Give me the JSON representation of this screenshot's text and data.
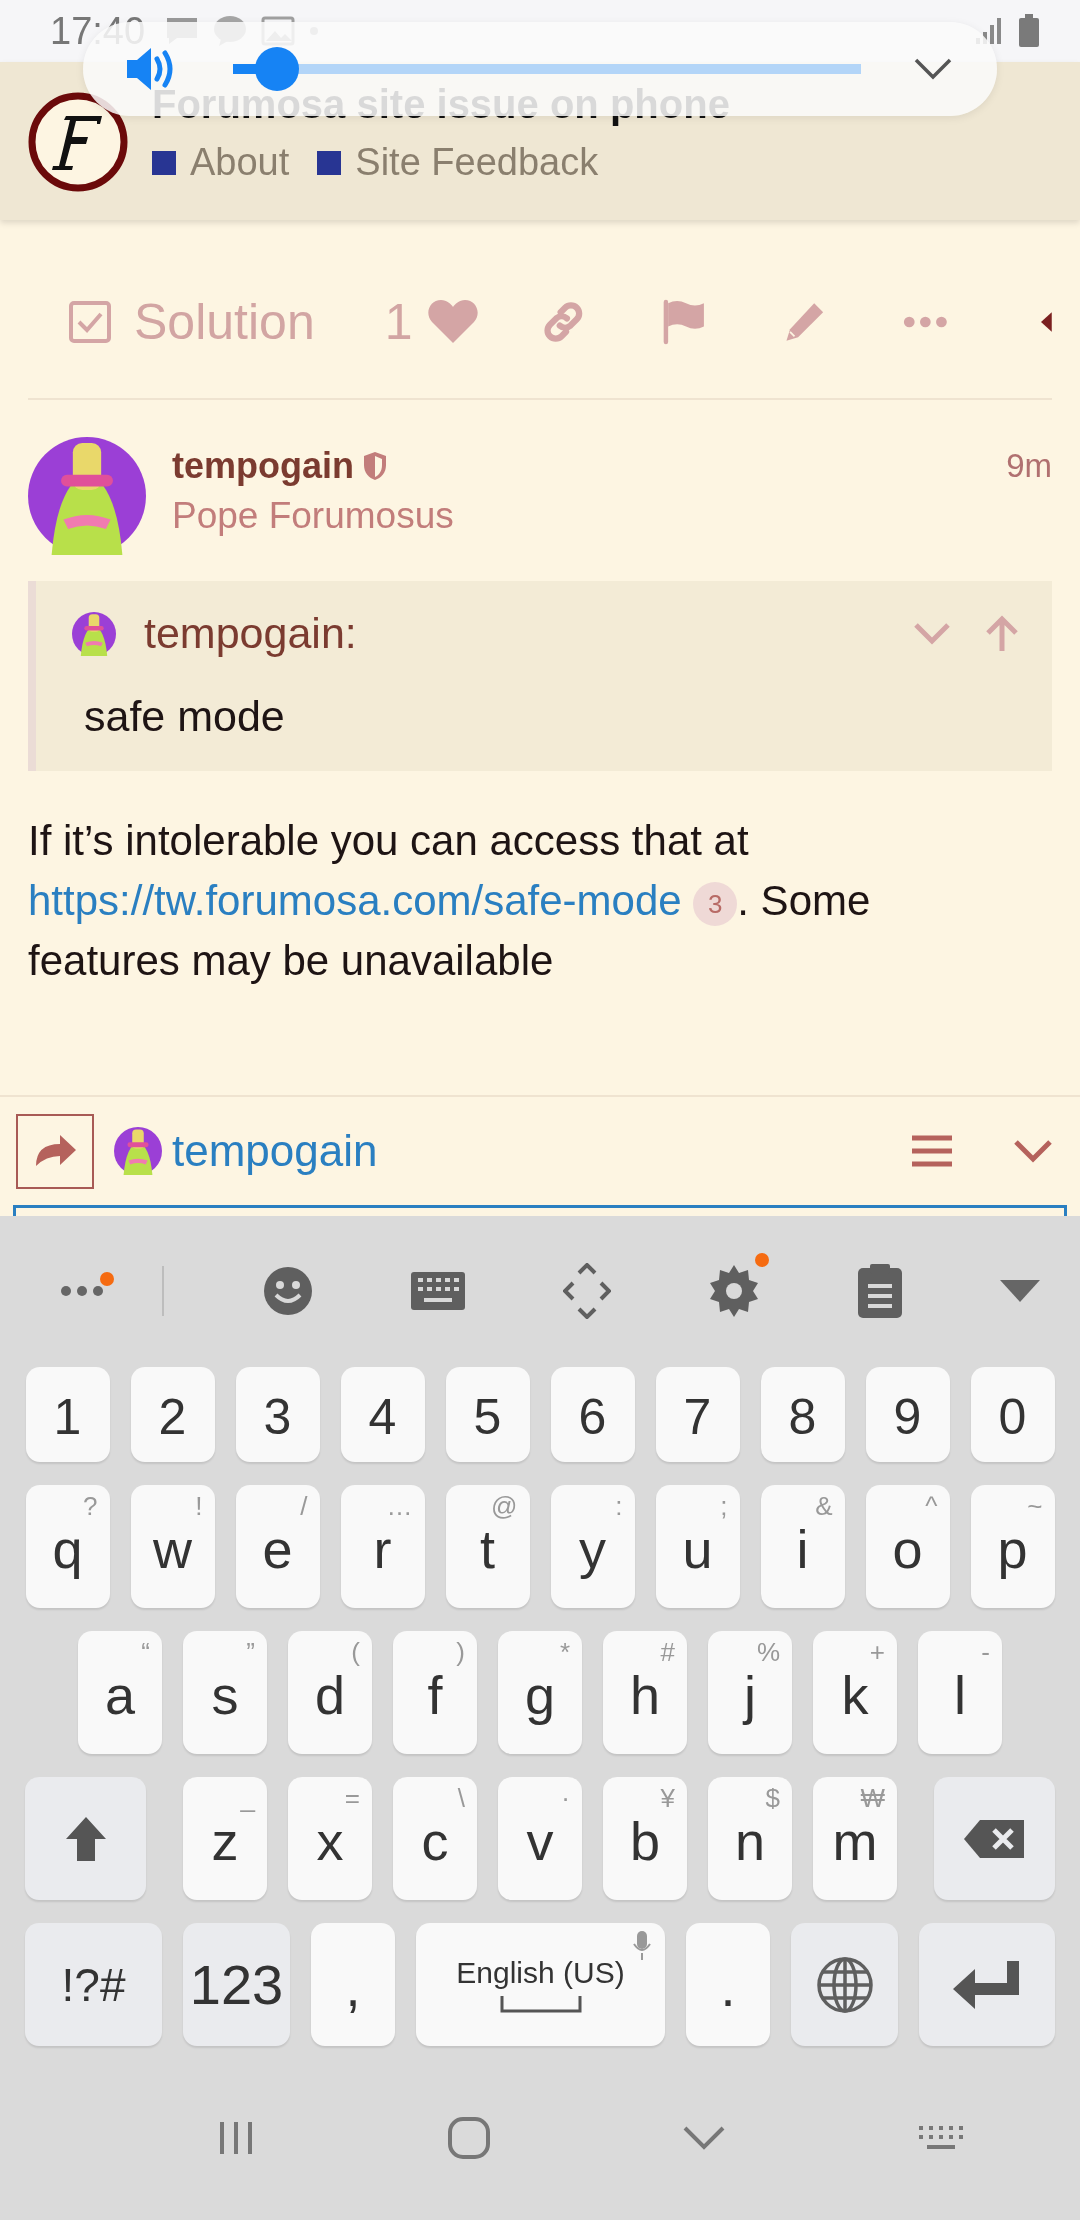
{
  "status_bar": {
    "time": "17:40"
  },
  "volume_popup": {
    "level": 0.07
  },
  "topic": {
    "title": "Forumosa site issue on phone",
    "categories": [
      {
        "name": "About"
      },
      {
        "name": "Site Feedback"
      }
    ]
  },
  "post_actions": {
    "solution_label": "Solution",
    "like_count": "1"
  },
  "post": {
    "username": "tempogain",
    "user_title": "Pope Forumosus",
    "time": "9m",
    "quote": {
      "author": "tempogain:",
      "text": "safe mode"
    },
    "body": {
      "text_before": "If it’s intolerable you can access that at ",
      "link": "https://tw.forumosa.com/safe-mode",
      "link_clicks": "3",
      "text_after": ". Some features may be unavailable"
    }
  },
  "composer": {
    "reply_to": "tempogain"
  },
  "keyboard": {
    "toolbar": [
      {
        "kind": "more",
        "dot": true
      },
      {
        "kind": "emoji",
        "dot": false
      },
      {
        "kind": "keyboard",
        "dot": false
      },
      {
        "kind": "cursor",
        "dot": false
      },
      {
        "kind": "settings",
        "dot": true
      },
      {
        "kind": "clipboard",
        "dot": false
      },
      {
        "kind": "collapse",
        "dot": false
      }
    ],
    "rows": [
      [
        {
          "kind": "char",
          "label": "1"
        },
        {
          "kind": "char",
          "label": "2"
        },
        {
          "kind": "char",
          "label": "3"
        },
        {
          "kind": "char",
          "label": "4"
        },
        {
          "kind": "char",
          "label": "5"
        },
        {
          "kind": "char",
          "label": "6"
        },
        {
          "kind": "char",
          "label": "7"
        },
        {
          "kind": "char",
          "label": "8"
        },
        {
          "kind": "char",
          "label": "9"
        },
        {
          "kind": "char",
          "label": "0"
        }
      ],
      [
        {
          "kind": "char",
          "label": "q",
          "hint": "?"
        },
        {
          "kind": "char",
          "label": "w",
          "hint": "!"
        },
        {
          "kind": "char",
          "label": "e",
          "hint": "/"
        },
        {
          "kind": "char",
          "label": "r",
          "hint": "…"
        },
        {
          "kind": "char",
          "label": "t",
          "hint": "@"
        },
        {
          "kind": "char",
          "label": "y",
          "hint": ":"
        },
        {
          "kind": "char",
          "label": "u",
          "hint": ";"
        },
        {
          "kind": "char",
          "label": "i",
          "hint": "&"
        },
        {
          "kind": "char",
          "label": "o",
          "hint": "^"
        },
        {
          "kind": "char",
          "label": "p",
          "hint": "~"
        }
      ],
      [
        {
          "kind": "char",
          "label": "a",
          "hint": "“"
        },
        {
          "kind": "char",
          "label": "s",
          "hint": "”"
        },
        {
          "kind": "char",
          "label": "d",
          "hint": "("
        },
        {
          "kind": "char",
          "label": "f",
          "hint": ")"
        },
        {
          "kind": "char",
          "label": "g",
          "hint": "*"
        },
        {
          "kind": "char",
          "label": "h",
          "hint": "#"
        },
        {
          "kind": "char",
          "label": "j",
          "hint": "%"
        },
        {
          "kind": "char",
          "label": "k",
          "hint": "+"
        },
        {
          "kind": "char",
          "label": "l",
          "hint": "-"
        }
      ],
      [
        {
          "kind": "shift"
        },
        {
          "kind": "char",
          "label": "z",
          "hint": "_"
        },
        {
          "kind": "char",
          "label": "x",
          "hint": "="
        },
        {
          "kind": "char",
          "label": "c",
          "hint": "\\"
        },
        {
          "kind": "char",
          "label": "v",
          "hint": "·"
        },
        {
          "kind": "char",
          "label": "b",
          "hint": "¥"
        },
        {
          "kind": "char",
          "label": "n",
          "hint": "$"
        },
        {
          "kind": "char",
          "label": "m",
          "hint": "₩"
        },
        {
          "kind": "backspace"
        }
      ],
      [
        {
          "kind": "symbols",
          "label": "!?#"
        },
        {
          "kind": "numbers",
          "label": "123"
        },
        {
          "kind": "char",
          "label": ","
        },
        {
          "kind": "space",
          "label": "English (US)"
        },
        {
          "kind": "char",
          "label": "."
        },
        {
          "kind": "globe"
        },
        {
          "kind": "enter"
        }
      ]
    ]
  }
}
